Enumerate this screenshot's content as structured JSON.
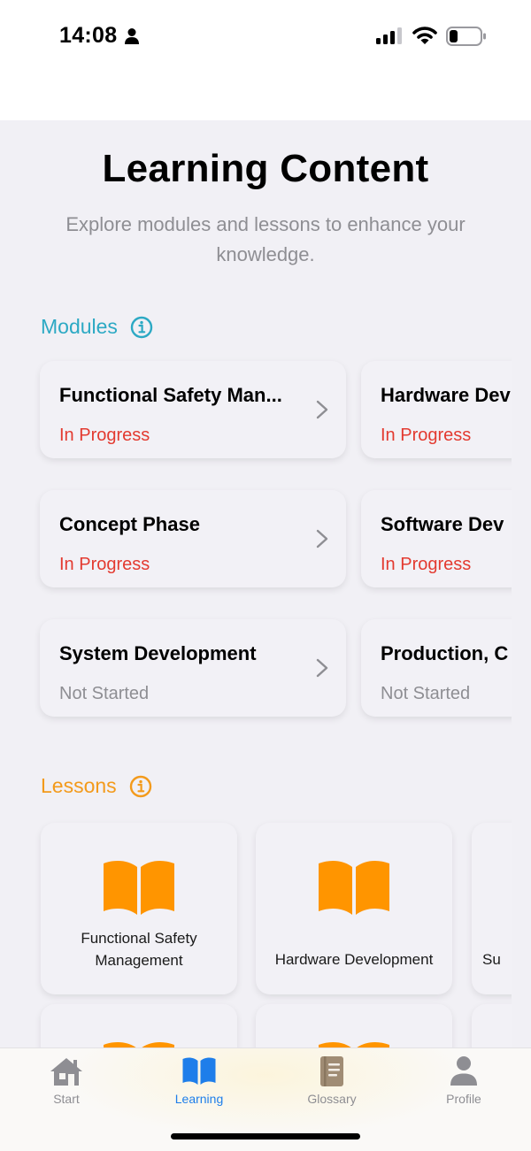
{
  "status_bar": {
    "time": "14:08"
  },
  "header": {
    "title": "Learning Content",
    "subtitle": "Explore modules and lessons to enhance your knowledge."
  },
  "modules": {
    "label": "Modules",
    "items": [
      {
        "title": "Functional Safety Man...",
        "status": "In Progress"
      },
      {
        "title": "Hardware Dev",
        "status": "In Progress"
      },
      {
        "title": "Concept Phase",
        "status": "In Progress"
      },
      {
        "title": "Software Dev",
        "status": "In Progress"
      },
      {
        "title": "System Development",
        "status": "Not Started"
      },
      {
        "title": "Production, C",
        "status": "Not Started"
      }
    ]
  },
  "lessons": {
    "label": "Lessons",
    "items": [
      {
        "label": "Functional Safety Management"
      },
      {
        "label": "Hardware Development"
      },
      {
        "label": "Su"
      }
    ]
  },
  "tab_bar": {
    "items": [
      {
        "label": "Start",
        "icon": "house-icon"
      },
      {
        "label": "Learning",
        "icon": "book-icon"
      },
      {
        "label": "Glossary",
        "icon": "glossary-book-icon"
      },
      {
        "label": "Profile",
        "icon": "person-icon"
      }
    ],
    "active": "Learning"
  },
  "colors": {
    "modules_accent": "#2CA9C4",
    "lessons_accent": "#F39A1B",
    "in_progress": "#E33A30",
    "not_started": "#8E8E93",
    "active_tab": "#1E7EEA",
    "book_icon": "#FF9500"
  }
}
